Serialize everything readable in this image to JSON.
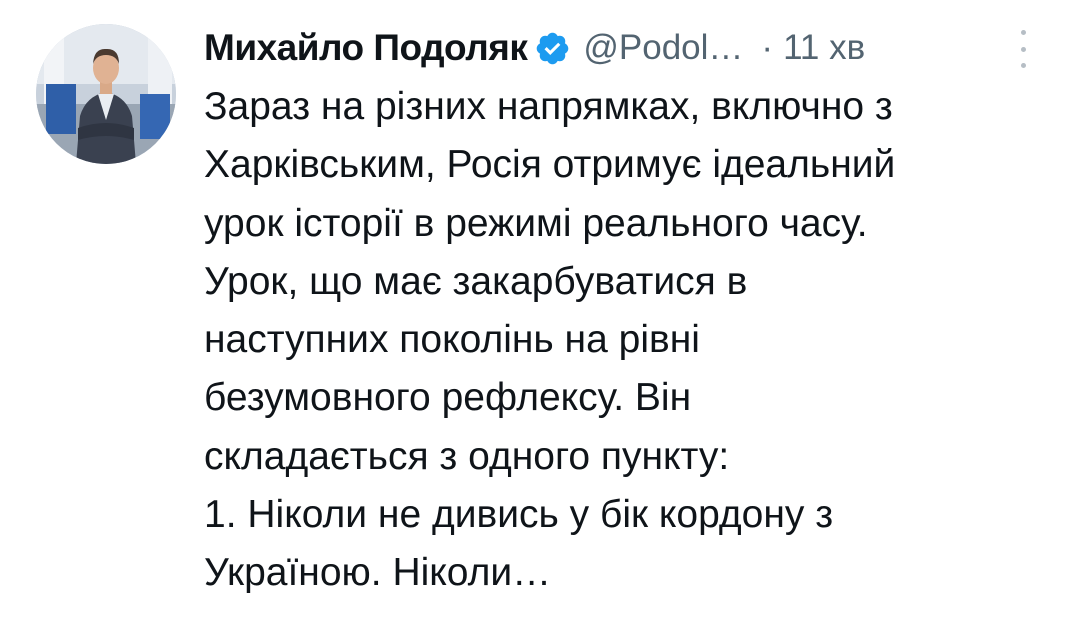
{
  "tweet": {
    "author_name": "Михайло Подоляк",
    "handle": "@Podol…",
    "separator": "·",
    "time": "11 хв",
    "verified_icon": "verified-badge-icon",
    "more_icon": "more-vertical-icon",
    "text_lines": [
      "Зараз на різних напрямках, включно з",
      "Харківським, Росія отримує ідеальний",
      "урок історії в режимі реального часу.",
      "Урок, що має закарбуватися в",
      "наступних поколінь на рівні",
      "безумовного рефлексу. Він",
      "складається з одного пункту:",
      "1. Ніколи не дивись у бік кордону з",
      "Україною. Ніколи…"
    ]
  },
  "colors": {
    "text_primary": "#0f1419",
    "text_secondary": "#536471",
    "verified_blue": "#1d9bf0",
    "background": "#ffffff"
  }
}
